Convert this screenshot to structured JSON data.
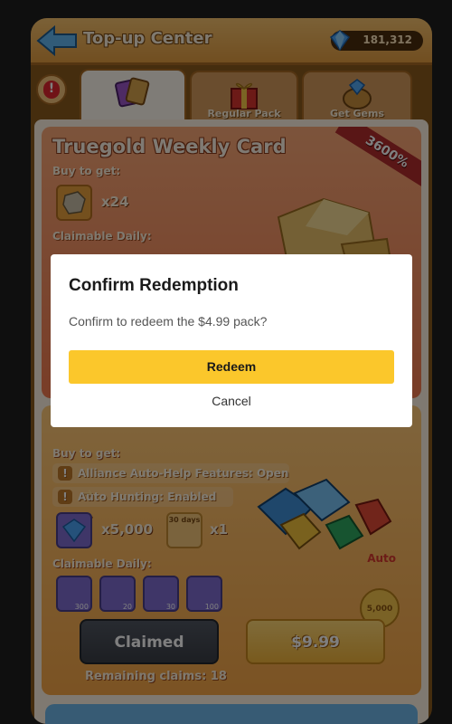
{
  "header": {
    "title": "Top-up Center",
    "gem_count": "181,312"
  },
  "tabs": [
    {
      "label": ""
    },
    {
      "label": "Regular Pack"
    },
    {
      "label": "Get Gems"
    }
  ],
  "cards": {
    "weekly": {
      "title": "Truegold Weekly Card",
      "ribbon": "3600%",
      "buy_to_get_label": "Buy to get:",
      "item_qty": "x24",
      "claimable_daily_label": "Claimable Daily:"
    },
    "monthly": {
      "buy_to_get_label": "Buy to get:",
      "feature_1": "Alliance Auto-Help Features: Open",
      "feature_2": "Auto Hunting: Enabled",
      "gems_qty": "x5,000",
      "days_badge": "30 days",
      "days_qty": "x1",
      "auto_label": "Auto",
      "claimable_daily_label": "Claimable Daily:",
      "daily_counts": [
        "300",
        "20",
        "30",
        "100"
      ],
      "coin_bonus": "5,000",
      "claimed_label": "Claimed",
      "price_label": "$9.99",
      "remaining_label": "Remaining claims: 18"
    }
  },
  "modal": {
    "title": "Confirm Redemption",
    "message": "Confirm to redeem the $4.99 pack?",
    "redeem_label": "Redeem",
    "cancel_label": "Cancel"
  },
  "colors": {
    "accent": "#fbc72b",
    "overlay": "rgba(0,0,0,0.5)"
  }
}
